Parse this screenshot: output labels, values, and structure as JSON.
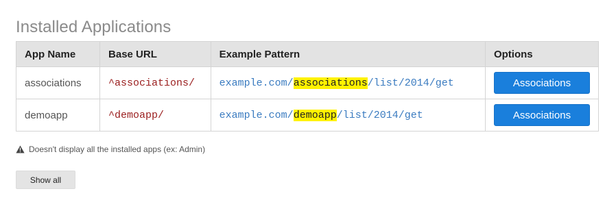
{
  "page": {
    "title": "Installed Applications"
  },
  "table": {
    "headers": [
      "App Name",
      "Base URL",
      "Example Pattern",
      "Options"
    ],
    "rows": [
      {
        "name": "associations",
        "base_url": "^associations/",
        "pattern_prefix": "example.com/",
        "pattern_highlight": "associations",
        "pattern_suffix": "/list/2014/get",
        "button": "Associations"
      },
      {
        "name": "demoapp",
        "base_url": "^demoapp/",
        "pattern_prefix": "example.com/",
        "pattern_highlight": "demoapp",
        "pattern_suffix": "/list/2014/get",
        "button": "Associations"
      }
    ]
  },
  "note": {
    "icon": "warning-icon",
    "text": "Doesn't display all the installed apps (ex: Admin)"
  },
  "show_all_label": "Show all",
  "colors": {
    "primary_button": "#1a7fdc",
    "highlight": "#fff200",
    "base_url": "#9a1d1d",
    "pattern": "#3a7bc0"
  }
}
